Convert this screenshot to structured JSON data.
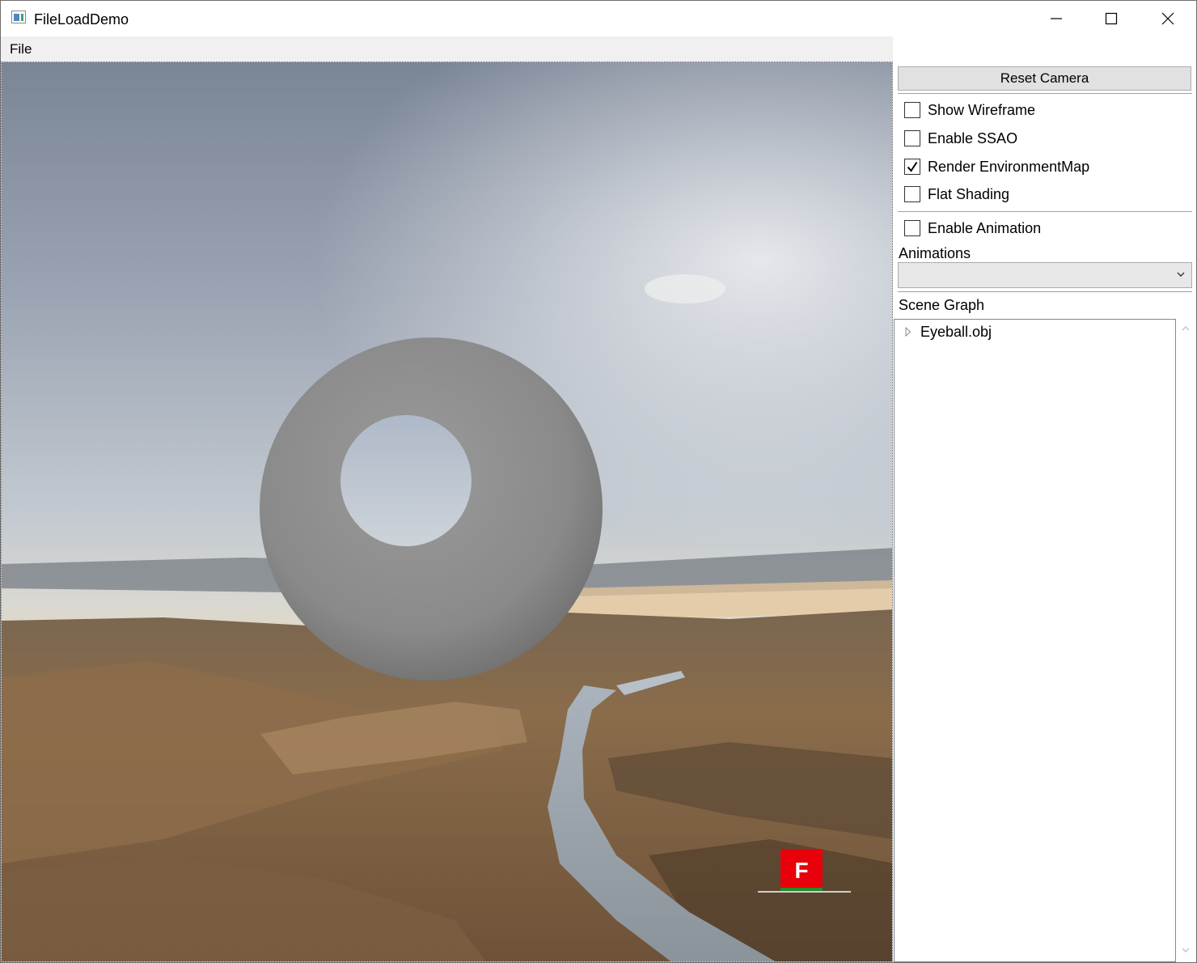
{
  "window": {
    "title": "FileLoadDemo",
    "controls": [
      "minimize-icon",
      "maximize-icon",
      "close-icon"
    ]
  },
  "menu": {
    "file_label": "File"
  },
  "viewport": {
    "description_icons": [
      "eyeball-model",
      "view-cube"
    ],
    "view_cube_label": "F",
    "colors": {
      "view_cube": "#e8000b"
    }
  },
  "panel": {
    "reset_camera_label": "Reset Camera",
    "options": [
      {
        "label": "Show Wireframe",
        "checked": false
      },
      {
        "label": "Enable SSAO",
        "checked": false
      },
      {
        "label": "Render EnvironmentMap",
        "checked": true
      },
      {
        "label": "Flat Shading",
        "checked": false
      }
    ],
    "enable_animation": {
      "label": "Enable Animation",
      "checked": false
    },
    "animations_label": "Animations",
    "animations_selected": "",
    "scene_graph_label": "Scene Graph",
    "scene_graph_items": [
      {
        "label": "Eyeball.obj",
        "expanded": false
      }
    ]
  }
}
